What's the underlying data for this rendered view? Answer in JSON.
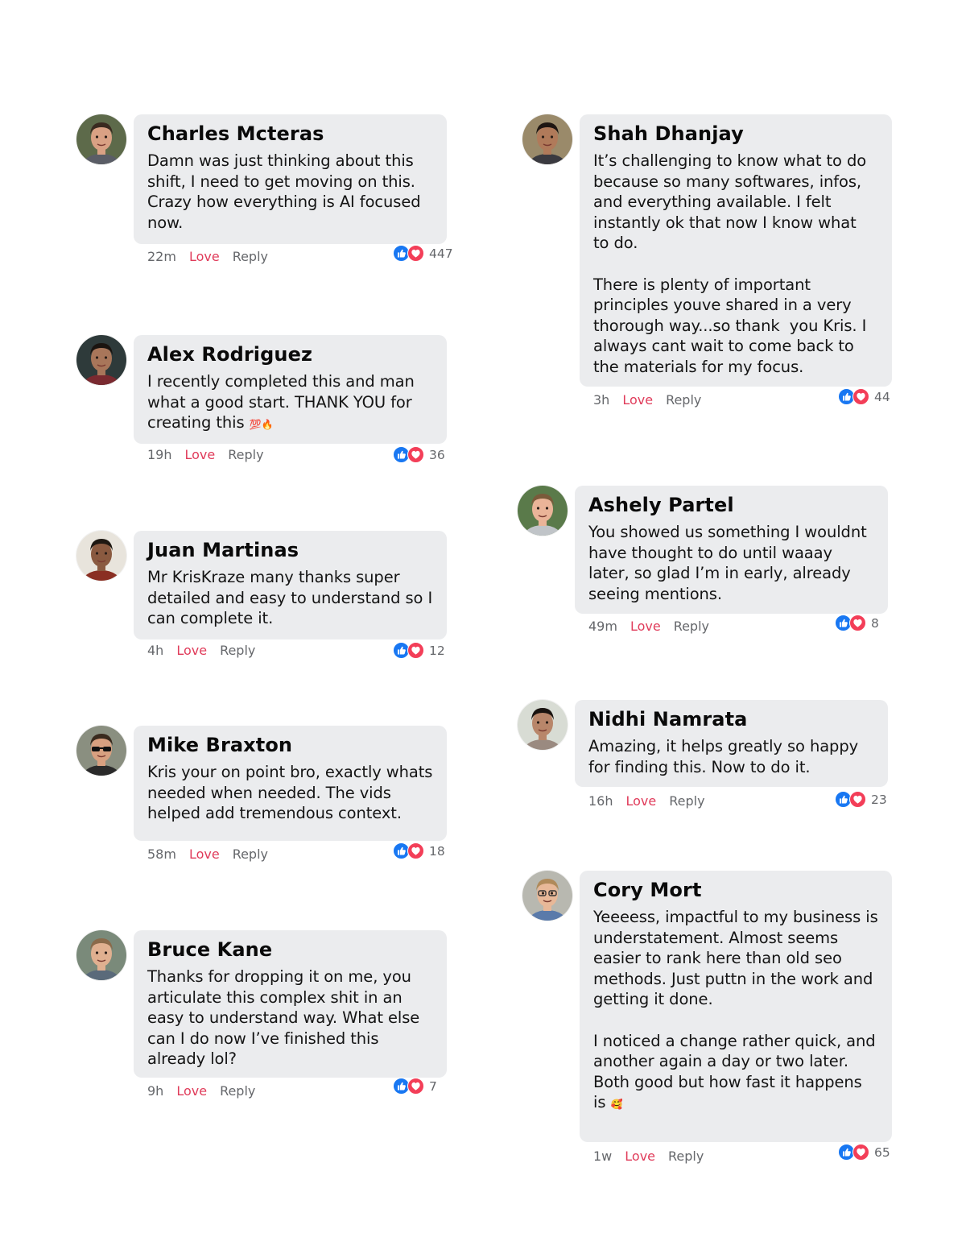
{
  "labels": {
    "love": "Love",
    "reply": "Reply"
  },
  "colors": {
    "like": "#1877f2",
    "love": "#f33e58",
    "bubble": "#ebecee",
    "meta": "#65676b"
  },
  "comments": [
    {
      "name": "Charles Mcteras",
      "text": "Damn was just thinking about this\nshift, I need to get moving on this.\nCrazy how everything is AI focused\nnow.",
      "time": "22m",
      "count": "447"
    },
    {
      "name": "Alex Rodriguez",
      "text": "I recently completed this and man\nwhat a good start. THANK YOU for\ncreating this",
      "emoji": "💯🔥",
      "time": "19h",
      "count": "36"
    },
    {
      "name": "Juan Martinas",
      "text": "Mr KrisKraze many thanks super\ndetailed and easy to understand so I\ncan complete it.",
      "time": "4h",
      "count": "12"
    },
    {
      "name": "Mike Braxton",
      "text": "Kris your on point bro, exactly whats\nneeded when needed. The vids\nhelped add tremendous context.",
      "time": "58m",
      "count": "18"
    },
    {
      "name": "Bruce Kane",
      "text": "Thanks for dropping it on me, you\narticulate this complex shit in an\neasy to understand way. What else\ncan I do now I’ve finished this\nalready lol?",
      "time": "9h",
      "count": "7"
    },
    {
      "name": "Shah Dhanjay",
      "text": "It’s challenging to know what to do\nbecause so many softwares, infos,\nand everything available. I felt\ninstantly ok that now I know what\nto do.\n\nThere is plenty of important\nprinciples youve shared in a very\nthorough way...so thank  you Kris. I\nalways cant wait to come back to\nthe materials for my focus.",
      "time": "3h",
      "count": "44"
    },
    {
      "name": "Ashely Partel",
      "text": "You showed us something I wouldnt\nhave thought to do until waaay\nlater, so glad I’m in early, already\nseeing mentions.",
      "time": "49m",
      "count": "8"
    },
    {
      "name": "Nidhi Namrata",
      "text": "Amazing, it helps greatly so happy\nfor finding this. Now to do it.",
      "time": "16h",
      "count": "23"
    },
    {
      "name": "Cory Mort",
      "text": "Yeeeess, impactful to my business is\nunderstatement. Almost seems\neasier to rank here than old seo\nmethods. Just puttn in the work and\ngetting it done.\n\nI noticed a change rather quick, and\nanother again a day or two later.\nBoth good but how fast it happens\nis",
      "emoji": "🥰",
      "time": "1w",
      "count": "65"
    }
  ]
}
